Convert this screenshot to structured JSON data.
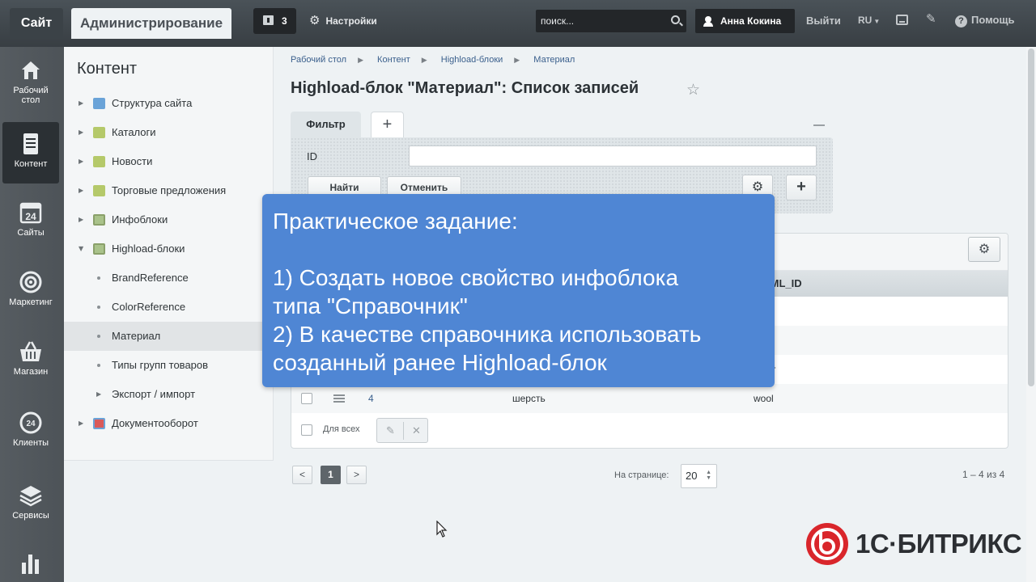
{
  "topbar": {
    "site_label": "Сайт",
    "admin_label": "Администрирование",
    "notifications_count": "3",
    "settings_label": "Настройки",
    "search_placeholder": "поиск...",
    "user_name": "Анна Кокина",
    "logout_label": "Выйти",
    "language": "RU",
    "help_label": "Помощь"
  },
  "rail": {
    "items": [
      {
        "label_line1": "Рабочий",
        "label_line2": "стол"
      },
      {
        "label_line1": "Контент",
        "label_line2": ""
      },
      {
        "label_line1": "Сайты",
        "label_line2": ""
      },
      {
        "label_line1": "Маркетинг",
        "label_line2": ""
      },
      {
        "label_line1": "Магазин",
        "label_line2": ""
      },
      {
        "label_line1": "Клиенты",
        "label_line2": ""
      },
      {
        "label_line1": "Сервисы",
        "label_line2": ""
      }
    ],
    "calendar_day": "24",
    "clients_badge": "24"
  },
  "panel": {
    "title": "Контент",
    "items": [
      {
        "label": "Структура сайта"
      },
      {
        "label": "Каталоги"
      },
      {
        "label": "Новости"
      },
      {
        "label": "Торговые предложения"
      },
      {
        "label": "Инфоблоки"
      },
      {
        "label": "Highload-блоки"
      },
      {
        "label": "BrandReference"
      },
      {
        "label": "ColorReference"
      },
      {
        "label": "Материал"
      },
      {
        "label": "Типы групп товаров"
      },
      {
        "label": "Экспорт / импорт"
      },
      {
        "label": "Документооборот"
      }
    ]
  },
  "breadcrumb": [
    "Рабочий стол",
    "Контент",
    "Highload-блоки",
    "Материал"
  ],
  "page_title": "Highload-блок \"Материал\": Список записей",
  "filter": {
    "tab_label": "Фильтр",
    "add_label": "+",
    "field_label": "ID",
    "field_value": "",
    "find_label": "Найти",
    "cancel_label": "Отменить",
    "plus_label": "+"
  },
  "grid": {
    "columns": [
      "XML_ID"
    ],
    "rows": [
      {
        "id": "",
        "name": "",
        "xml": "on"
      },
      {
        "id": "",
        "name": "",
        "xml": ""
      },
      {
        "id": "",
        "name": "",
        "xml": "her"
      },
      {
        "id": "4",
        "name": "шерсть",
        "xml": "wool"
      }
    ],
    "for_all_label": "Для всех"
  },
  "pager": {
    "prev": "<",
    "current": "1",
    "next": ">",
    "per_page_label": "На странице:",
    "per_page_value": "20",
    "total": "1 – 4 из 4"
  },
  "overlay": {
    "title": "Практическое задание:",
    "line1": "1) Создать новое свойство инфоблока",
    "line2": "типа \"Справочник\"",
    "line3": "2) В качестве справочника использовать",
    "line4": "созданный ранее Highload-блок"
  },
  "logo": {
    "text": "1С·БИТРИКС"
  },
  "colors": {
    "overlay_blue": "#4f86d4",
    "topbar": "#3f454a",
    "rail": "#535a5f",
    "logo_red": "#d9262b"
  }
}
